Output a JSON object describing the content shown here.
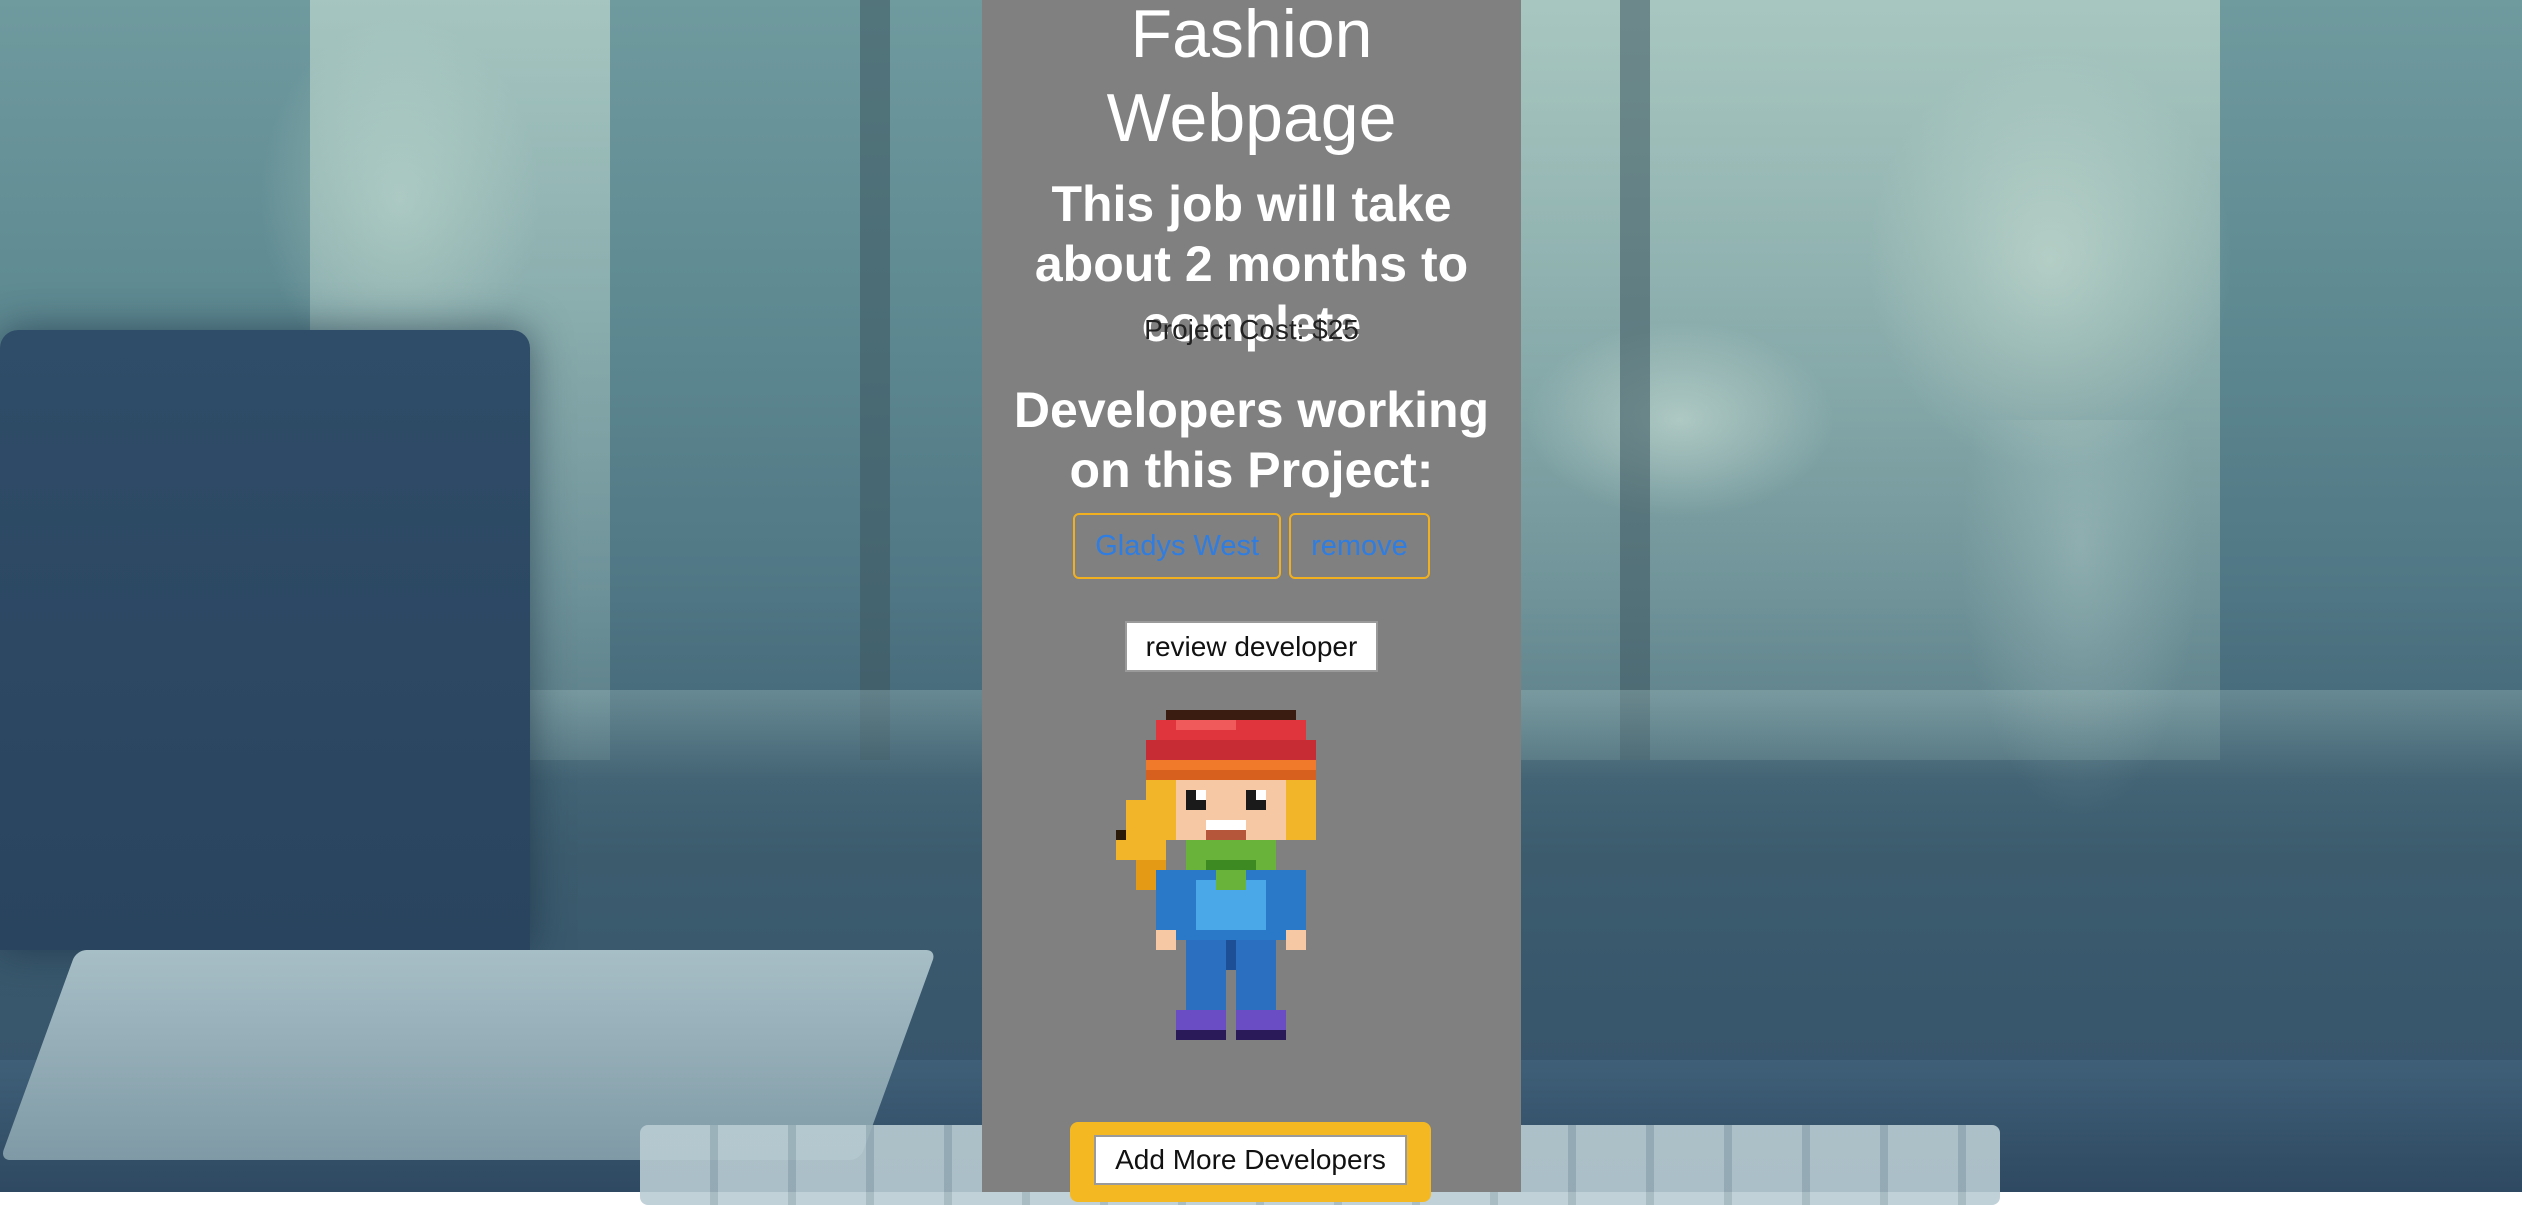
{
  "project": {
    "title": "Fashion Webpage",
    "duration": "This job will take about 2 months to complete",
    "cost": "Project Cost: $25"
  },
  "developers": {
    "heading": "Developers working on this Project:",
    "items": [
      {
        "name": "Gladys West",
        "remove_label": "remove"
      }
    ],
    "review_label": "review developer",
    "add_label": "Add More Developers"
  },
  "colors": {
    "panel": "#808080",
    "accent": "#f4b922",
    "link": "#2f7de1"
  }
}
